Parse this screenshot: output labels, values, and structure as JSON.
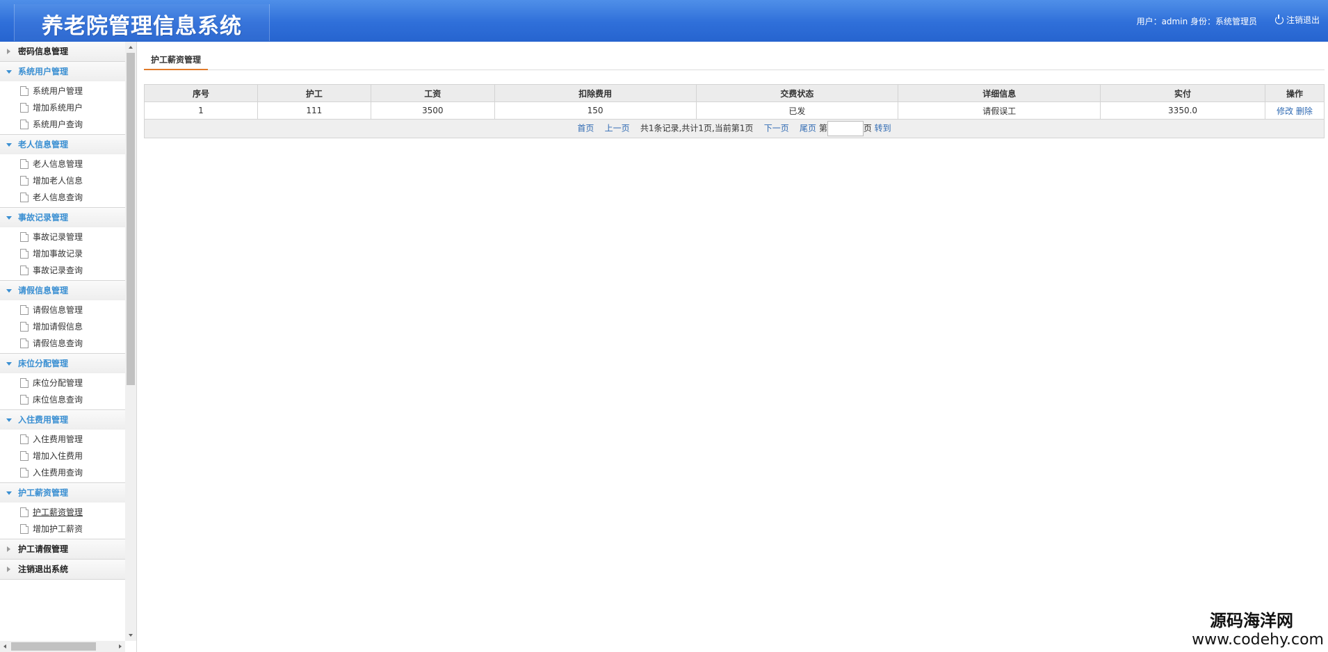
{
  "header": {
    "title": "养老院管理信息系统",
    "user_info": "用户：admin 身份：系统管理员",
    "logout": "注销退出"
  },
  "sidebar": {
    "groups": [
      {
        "label": "密码信息管理",
        "open": false,
        "items": []
      },
      {
        "label": "系统用户管理",
        "open": true,
        "items": [
          "系统用户管理",
          "增加系统用户",
          "系统用户查询"
        ]
      },
      {
        "label": "老人信息管理",
        "open": true,
        "items": [
          "老人信息管理",
          "增加老人信息",
          "老人信息查询"
        ]
      },
      {
        "label": "事故记录管理",
        "open": true,
        "items": [
          "事故记录管理",
          "增加事故记录",
          "事故记录查询"
        ]
      },
      {
        "label": "请假信息管理",
        "open": true,
        "items": [
          "请假信息管理",
          "增加请假信息",
          "请假信息查询"
        ]
      },
      {
        "label": "床位分配管理",
        "open": true,
        "items": [
          "床位分配管理",
          "床位信息查询"
        ]
      },
      {
        "label": "入住费用管理",
        "open": true,
        "items": [
          "入住费用管理",
          "增加入住费用",
          "入住费用查询"
        ]
      },
      {
        "label": "护工薪资管理",
        "open": true,
        "items": [
          "护工薪资管理",
          "增加护工薪资"
        ]
      },
      {
        "label": "护工请假管理",
        "open": false,
        "items": []
      },
      {
        "label": "注销退出系统",
        "open": false,
        "items": []
      }
    ],
    "active_item": "护工薪资管理"
  },
  "main": {
    "tab": "护工薪资管理",
    "table": {
      "headers": [
        "序号",
        "护工",
        "工资",
        "扣除费用",
        "交费状态",
        "详细信息",
        "实付",
        "操作"
      ],
      "rows": [
        {
          "no": "1",
          "worker": "111",
          "salary": "3500",
          "deduction": "150",
          "status": "已发",
          "detail": "请假误工",
          "paid": "3350.0",
          "edit": "修改",
          "delete": "删除"
        }
      ]
    },
    "pager": {
      "first": "首页",
      "prev": "上一页",
      "summary": "共1条记录,共计1页,当前第1页",
      "next": "下一页",
      "last": "尾页",
      "page_prefix": "第",
      "page_value": "",
      "page_suffix": "页",
      "go": "转到"
    }
  },
  "watermark": {
    "line1": "源码海洋网",
    "line2": "www.codehy.com"
  }
}
